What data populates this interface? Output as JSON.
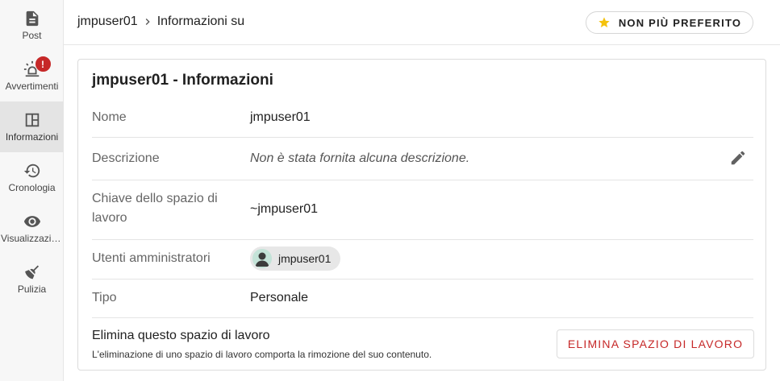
{
  "sidebar": {
    "items": [
      {
        "label": "Post",
        "icon": "document-icon"
      },
      {
        "label": "Avvertimenti",
        "icon": "alarm-light-icon",
        "badge": "!"
      },
      {
        "label": "Informazioni",
        "icon": "layout-panel-icon",
        "active": true
      },
      {
        "label": "Cronologia",
        "icon": "history-icon"
      },
      {
        "label": "Visualizzazioni",
        "icon": "eye-icon"
      },
      {
        "label": "Pulizia",
        "icon": "broom-icon"
      }
    ]
  },
  "header": {
    "breadcrumb": {
      "workspace": "jmpuser01",
      "page": "Informazioni su"
    },
    "favorite_label": "NON PIÙ PREFERITO"
  },
  "card": {
    "title": "jmpuser01 - Informazioni",
    "rows": {
      "name": {
        "label": "Nome",
        "value": "jmpuser01"
      },
      "description": {
        "label": "Descrizione",
        "value": "Non è stata fornita alcuna descrizione."
      },
      "key": {
        "label_line1": "Chiave dello spazio di",
        "label_line2": "lavoro",
        "value": "~jmpuser01"
      },
      "admins": {
        "label": "Utenti amministratori",
        "user": "jmpuser01"
      },
      "type": {
        "label": "Tipo",
        "value": "Personale"
      }
    },
    "delete": {
      "title": "Elimina questo spazio di lavoro",
      "description": "L'eliminazione di uno spazio di lavoro comporta la rimozione del suo contenuto.",
      "button_label": "ELIMINA SPAZIO DI LAVORO"
    }
  },
  "colors": {
    "accent_red": "#c62828",
    "star": "#f4c20d",
    "sidebar_bg": "#f7f7f7",
    "active_bg": "#e4e4e4"
  }
}
